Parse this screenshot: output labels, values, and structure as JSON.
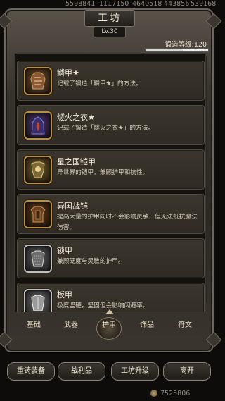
{
  "topbar": {
    "numbers": [
      "5598841",
      "1117150",
      "4640518",
      "443856",
      "539168"
    ]
  },
  "header": {
    "title": "工坊",
    "level": "LV.30"
  },
  "forge": {
    "label": "锻造等级:120",
    "progress": 0.6
  },
  "items": [
    {
      "name": "鳞甲★",
      "desc": "记载了锻造「鳞甲★」的方法。",
      "icon": "scale-armor-recipe-icon"
    },
    {
      "name": "燧火之衣★",
      "desc": "记载了锻造「燧火之衣★」的方法。",
      "icon": "flame-robe-recipe-icon"
    },
    {
      "name": "星之国铠甲",
      "desc": "异世界的铠甲，兼顾护甲和抗性。",
      "icon": "star-armor-icon"
    },
    {
      "name": "异国战铠",
      "desc": "提高大量的护甲同时不会影响灵敏，但无法抵抗魔法伤害。",
      "icon": "foreign-war-armor-icon"
    },
    {
      "name": "锁甲",
      "desc": "兼顾硬度与灵敏的护甲。",
      "icon": "chainmail-icon"
    },
    {
      "name": "板甲",
      "desc": "极度坚硬，坚固但会影响闪避率。",
      "icon": "plate-armor-icon"
    }
  ],
  "tabs": [
    "基础",
    "武器",
    "护甲",
    "饰品",
    "符文"
  ],
  "active_tab": "护甲",
  "buttons": {
    "recast": "重铸装备",
    "loot": "战利品",
    "upgrade": "工坊升级",
    "leave": "离开"
  },
  "gold": "7525806",
  "colors": {
    "icon_border_gold": "#b89040",
    "icon_border_silver": "#bfbfbf",
    "panel": "#2f2b24"
  }
}
